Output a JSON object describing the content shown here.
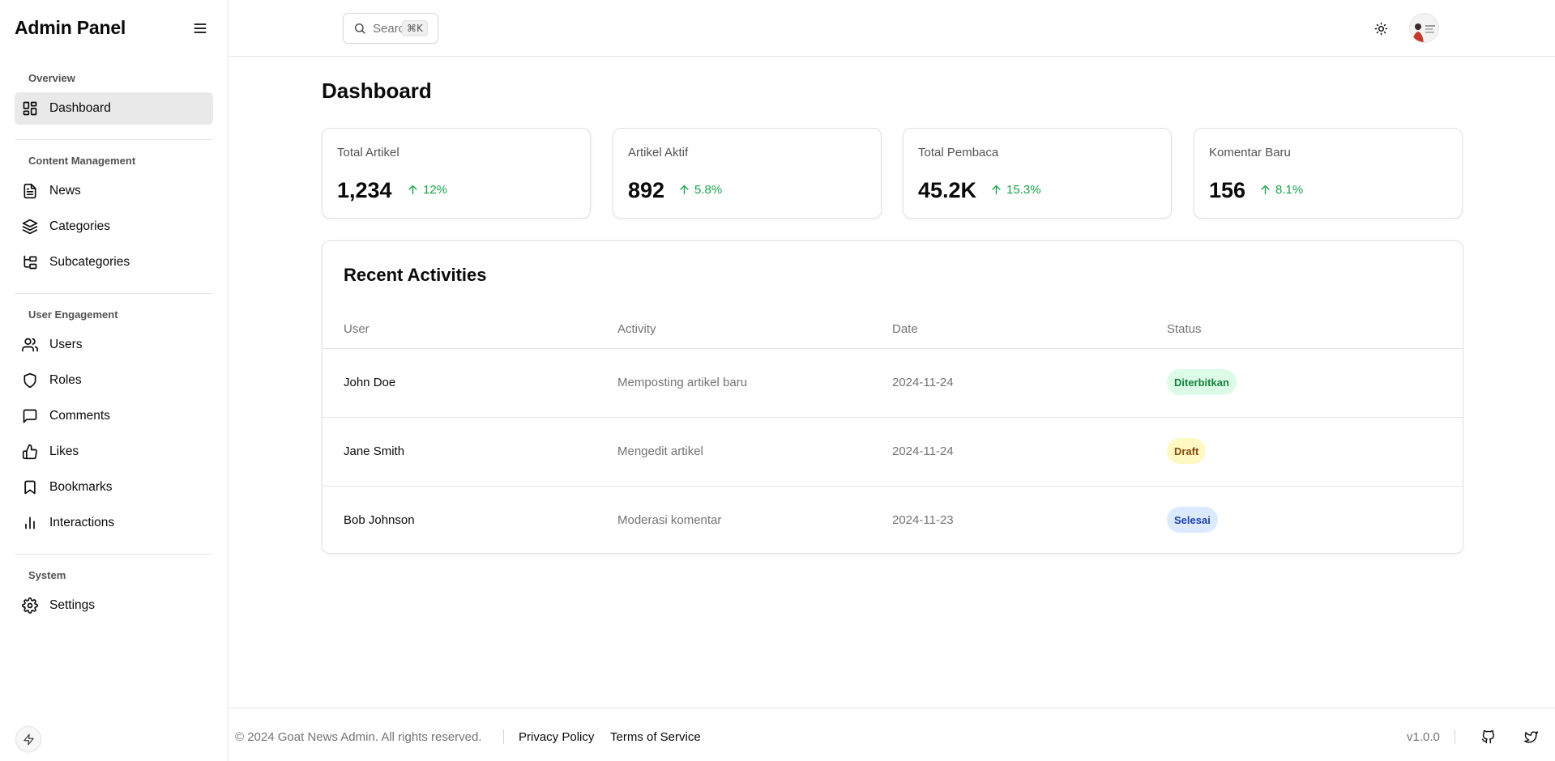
{
  "sidebar": {
    "title": "Admin Panel",
    "groups": [
      {
        "label": "Overview",
        "items": [
          {
            "label": "Dashboard",
            "icon": "dashboard-icon"
          }
        ]
      },
      {
        "label": "Content Management",
        "items": [
          {
            "label": "News",
            "icon": "file-text-icon"
          },
          {
            "label": "Categories",
            "icon": "layers-icon"
          },
          {
            "label": "Subcategories",
            "icon": "folder-tree-icon"
          }
        ]
      },
      {
        "label": "User Engagement",
        "items": [
          {
            "label": "Users",
            "icon": "users-icon"
          },
          {
            "label": "Roles",
            "icon": "shield-icon"
          },
          {
            "label": "Comments",
            "icon": "message-square-icon"
          },
          {
            "label": "Likes",
            "icon": "thumbs-up-icon"
          },
          {
            "label": "Bookmarks",
            "icon": "bookmark-icon"
          },
          {
            "label": "Interactions",
            "icon": "bar-chart-icon"
          }
        ]
      },
      {
        "label": "System",
        "items": [
          {
            "label": "Settings",
            "icon": "gear-icon"
          }
        ]
      }
    ]
  },
  "topbar": {
    "search_placeholder": "Search...",
    "search_shortcut": "⌘K"
  },
  "main": {
    "title": "Dashboard",
    "stats": [
      {
        "label": "Total Artikel",
        "value": "1,234",
        "trend": "12%"
      },
      {
        "label": "Artikel Aktif",
        "value": "892",
        "trend": "5.8%"
      },
      {
        "label": "Total Pembaca",
        "value": "45.2K",
        "trend": "15.3%"
      },
      {
        "label": "Komentar Baru",
        "value": "156",
        "trend": "8.1%"
      }
    ],
    "activities": {
      "title": "Recent Activities",
      "columns": [
        "User",
        "Activity",
        "Date",
        "Status"
      ],
      "rows": [
        {
          "user": "John Doe",
          "activity": "Memposting artikel baru",
          "date": "2024-11-24",
          "status": "Diterbitkan"
        },
        {
          "user": "Jane Smith",
          "activity": "Mengedit artikel",
          "date": "2024-11-24",
          "status": "Draft"
        },
        {
          "user": "Bob Johnson",
          "activity": "Moderasi komentar",
          "date": "2024-11-23",
          "status": "Selesai"
        }
      ]
    }
  },
  "footer": {
    "copyright": "© 2024 Goat News Admin. All rights reserved.",
    "privacy": "Privacy Policy",
    "terms": "Terms of Service",
    "version": "v1.0.0"
  },
  "colors": {
    "accent_green": "#16a34a",
    "badge_published_bg": "#dcfce7",
    "badge_published_fg": "#15803d",
    "badge_draft_bg": "#fef9c3",
    "badge_draft_fg": "#854d0e",
    "badge_done_bg": "#dbeafe",
    "badge_done_fg": "#1e40af"
  }
}
